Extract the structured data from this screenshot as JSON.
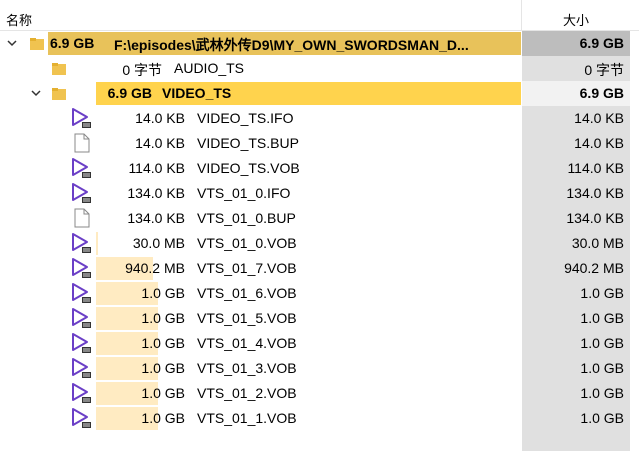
{
  "header": {
    "name_label": "名称",
    "size_label": "大小"
  },
  "root": {
    "size": "6.9 GB",
    "path": "F:\\episodes\\武林外传D9\\MY_OWN_SWORDSMAN_D..."
  },
  "audio": {
    "size": "0 字节",
    "name": "AUDIO_TS"
  },
  "video": {
    "size": "6.9 GB",
    "name": "VIDEO_TS"
  },
  "files": [
    {
      "size": "14.0 KB",
      "name": "VIDEO_TS.IFO",
      "icon": "vob-icon",
      "fill_fraction": 0.0
    },
    {
      "size": "14.0 KB",
      "name": "VIDEO_TS.BUP",
      "icon": "file-icon",
      "fill_fraction": 0.0
    },
    {
      "size": "114.0 KB",
      "name": "VIDEO_TS.VOB",
      "icon": "vob-icon",
      "fill_fraction": 0.0
    },
    {
      "size": "134.0 KB",
      "name": "VTS_01_0.IFO",
      "icon": "vob-icon",
      "fill_fraction": 0.0
    },
    {
      "size": "134.0 KB",
      "name": "VTS_01_0.BUP",
      "icon": "file-icon",
      "fill_fraction": 0.0
    },
    {
      "size": "30.0 MB",
      "name": "VTS_01_0.VOB",
      "icon": "vob-icon",
      "fill_fraction": 0.03
    },
    {
      "size": "940.2 MB",
      "name": "VTS_01_7.VOB",
      "icon": "vob-icon",
      "fill_fraction": 0.92
    },
    {
      "size": "1.0 GB",
      "name": "VTS_01_6.VOB",
      "icon": "vob-icon",
      "fill_fraction": 1.0
    },
    {
      "size": "1.0 GB",
      "name": "VTS_01_5.VOB",
      "icon": "vob-icon",
      "fill_fraction": 1.0
    },
    {
      "size": "1.0 GB",
      "name": "VTS_01_4.VOB",
      "icon": "vob-icon",
      "fill_fraction": 1.0
    },
    {
      "size": "1.0 GB",
      "name": "VTS_01_3.VOB",
      "icon": "vob-icon",
      "fill_fraction": 1.0
    },
    {
      "size": "1.0 GB",
      "name": "VTS_01_2.VOB",
      "icon": "vob-icon",
      "fill_fraction": 1.0
    },
    {
      "size": "1.0 GB",
      "name": "VTS_01_1.VOB",
      "icon": "vob-icon",
      "fill_fraction": 1.0
    }
  ],
  "colors": {
    "root_bar": "#e8c25a",
    "root_size_bg": "#bdbdbd",
    "video_bar": "#ffd34d",
    "video_size_bg": "#f2f2f2",
    "file_bar": "#ffebc2",
    "size_column": "#e0e0e0",
    "vob_icon": "#6b3fc7"
  }
}
